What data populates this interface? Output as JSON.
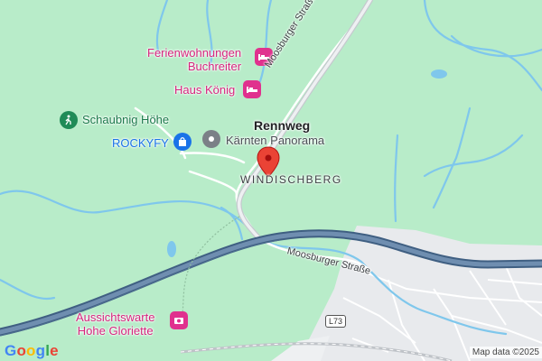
{
  "map": {
    "places": {
      "ferienwohnungen": "Ferienwohnungen\nBuchreiter",
      "haus_konig": "Haus König",
      "schaubnig": "Schaubnig Höhe",
      "rockyfy": "ROCKYFY",
      "karnten_panorama": "Kärnten Panorama",
      "aussichtswarte": "Aussichtswarte\nHohe Gloriette"
    },
    "town": "Rennweg",
    "district": "WINDISCHBERG",
    "roads": {
      "moosburger_north": "Moosburger Straße",
      "moosburger_south": "Moosburger Straße",
      "route_shield": "L73"
    },
    "icons": {
      "lodging": "bed-icon",
      "hiking": "hiker-icon",
      "shopping": "shopping-bag-icon",
      "landmark": "landmark-icon",
      "viewpoint": "camera-icon",
      "marker": "map-pin-icon"
    },
    "colors": {
      "terrain": "#b8ecc9",
      "water": "#7fc7ec",
      "highway": "#4e6f91",
      "urban": "#e8eaed",
      "poi_pink": "#d6247d",
      "poi_blue": "#1a73e8",
      "pin_red": "#ea4335"
    },
    "attribution": "Map data ©2025",
    "logo": "Google"
  }
}
